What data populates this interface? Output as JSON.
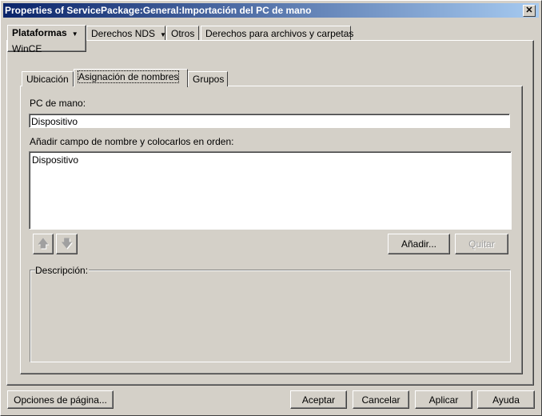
{
  "window": {
    "title": "Properties of ServicePackage:General:Importación del PC de mano",
    "close_label": "✕"
  },
  "outer_tabs": [
    {
      "label": "Plataformas",
      "sub": "WinCE"
    },
    {
      "label": "Derechos NDS"
    },
    {
      "label": "Otros"
    },
    {
      "label": "Derechos para archivos y carpetas"
    }
  ],
  "inner_tabs": [
    {
      "label": "Ubicación"
    },
    {
      "label": "Asignación de nombres"
    },
    {
      "label": "Grupos"
    }
  ],
  "form": {
    "pc_label": "PC de mano:",
    "pc_value": "Dispositivo",
    "list_label": "Añadir campo de nombre y colocarlos en orden:",
    "list_items": [
      "Dispositivo"
    ],
    "add_button": "Añadir...",
    "remove_button": "Quitar",
    "description_label": "Descripción:"
  },
  "footer": {
    "page_options": "Opciones de página...",
    "ok": "Aceptar",
    "cancel": "Cancelar",
    "apply": "Aplicar",
    "help": "Ayuda"
  }
}
